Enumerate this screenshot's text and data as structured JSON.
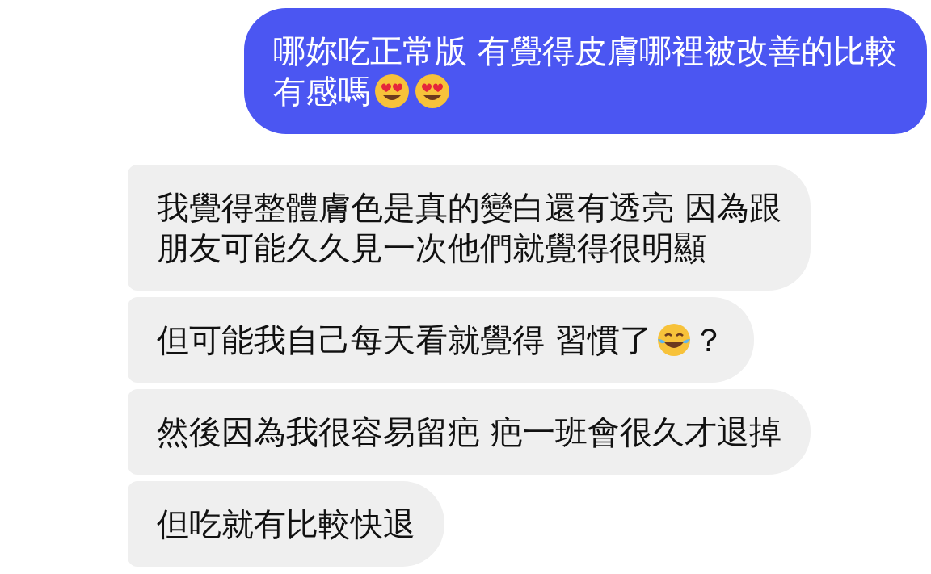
{
  "messages": [
    {
      "kind": "sent",
      "lines": [
        [
          {
            "kind": "text",
            "text": "哪妳吃正常版 有覺得皮膚哪裡被改善的比較"
          }
        ],
        [
          {
            "kind": "text",
            "text": "有感嗎"
          },
          {
            "kind": "heart_eyes"
          },
          {
            "kind": "heart_eyes"
          }
        ]
      ]
    },
    {
      "kind": "received",
      "lines": [
        [
          {
            "kind": "text",
            "text": "我覺得整體膚色是真的變白還有透亮 因為跟"
          }
        ],
        [
          {
            "kind": "text",
            "text": "朋友可能久久見一次他們就覺得很明顯"
          }
        ]
      ]
    },
    {
      "kind": "received",
      "lines": [
        [
          {
            "kind": "text",
            "text": "但可能我自己每天看就覺得 習慣了"
          },
          {
            "kind": "tears_of_joy"
          },
          {
            "kind": "text",
            "text": "？"
          }
        ]
      ]
    },
    {
      "kind": "received",
      "lines": [
        [
          {
            "kind": "text",
            "text": "然後因為我很容易留疤 疤一班會很久才退掉"
          }
        ]
      ]
    },
    {
      "kind": "received",
      "lines": [
        [
          {
            "kind": "text",
            "text": "但吃就有比較快退"
          }
        ]
      ]
    }
  ]
}
